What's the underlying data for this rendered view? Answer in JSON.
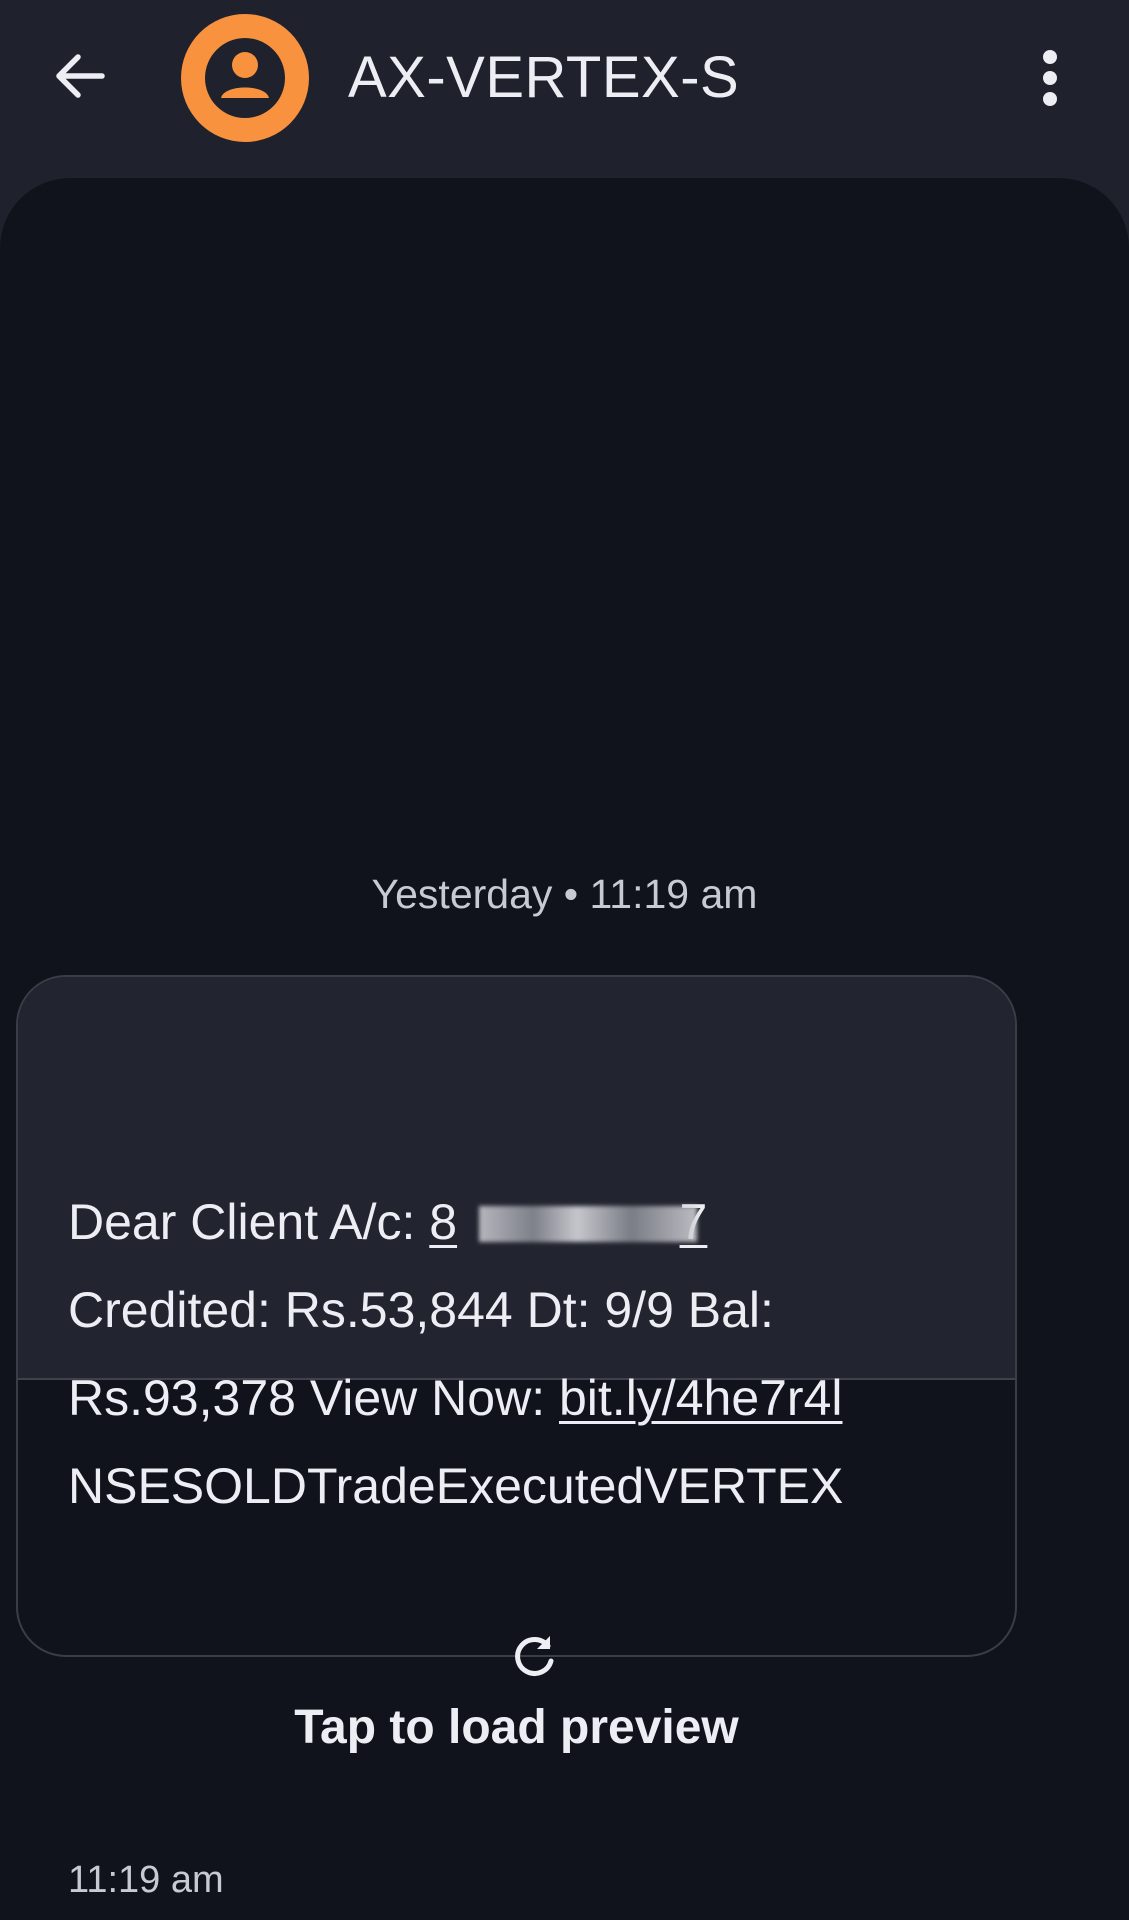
{
  "header": {
    "back_icon": "arrow-left-icon",
    "avatar_icon": "person-icon",
    "avatar_color": "#f9923f",
    "contact_name": "AX-VERTEX-S",
    "more_icon": "more-vertical-icon"
  },
  "conversation": {
    "date_divider": "Yesterday • 11:19 am",
    "message": {
      "line1_prefix": "Dear Client A/c: ",
      "account_first": "8",
      "account_last": "7",
      "line2": "Credited: Rs.53,844 Dt: 9/9 Bal:",
      "line3_prefix": "Rs.93,378 View Now: ",
      "link": "bit.ly/4he7r4l",
      "line4": "NSESOLDTradeExecutedVERTEX",
      "preview_icon": "refresh-icon",
      "preview_label": "Tap to load preview",
      "time": "11:19 am"
    }
  },
  "colors": {
    "header_bg": "#1f222c",
    "conversation_bg": "#11131c",
    "bubble_text_bg": "#22252f",
    "text": "#eceef4"
  }
}
